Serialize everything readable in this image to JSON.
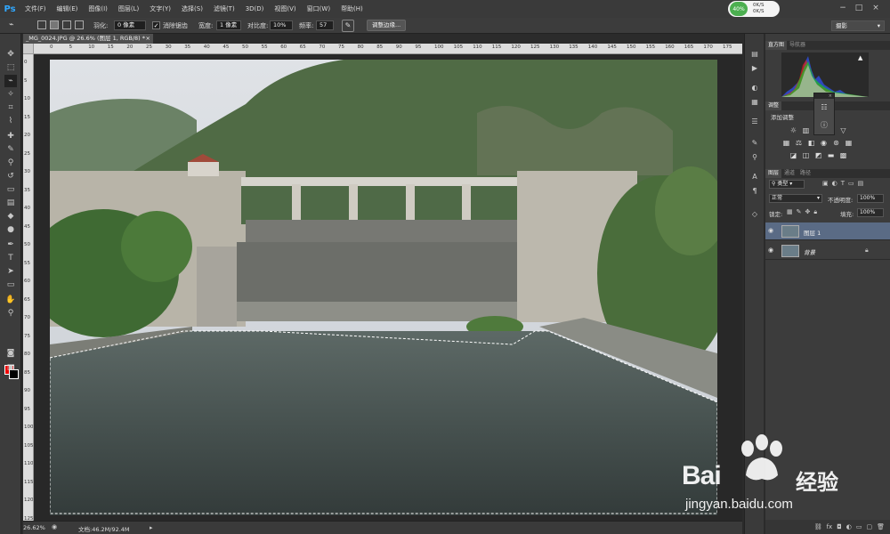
{
  "app": {
    "logo": "Ps"
  },
  "menu": [
    "文件(F)",
    "编辑(E)",
    "图像(I)",
    "图层(L)",
    "文字(Y)",
    "选择(S)",
    "滤镜(T)",
    "3D(D)",
    "视图(V)",
    "窗口(W)",
    "帮助(H)"
  ],
  "perf": {
    "percent": "40%",
    "up": "0K/S",
    "down": "0K/S"
  },
  "options": {
    "feather_label": "羽化:",
    "feather_value": "0 像素",
    "antialias_label": "消除锯齿",
    "antialias_checked": true,
    "width_label": "宽度:",
    "width_value": "1 像素",
    "contrast_label": "对比度:",
    "contrast_value": "10%",
    "frequency_label": "频率:",
    "frequency_value": "57",
    "refine_edge": "调整边缘...",
    "workspace": "摄影"
  },
  "document": {
    "tab_title": "_MG_0024.JPG @ 26.6% (图层 1, RGB/8) *",
    "close_glyph": "×"
  },
  "ruler": {
    "h_marks": [
      "0",
      "5",
      "10",
      "15",
      "20",
      "25",
      "30",
      "35",
      "40",
      "45",
      "50",
      "55",
      "60",
      "65",
      "70",
      "75",
      "80",
      "85",
      "90",
      "95",
      "100",
      "105",
      "110",
      "115",
      "120",
      "125",
      "130",
      "135",
      "140",
      "145",
      "150",
      "155",
      "160",
      "165",
      "170",
      "175"
    ],
    "v_marks": [
      "0",
      "5",
      "10",
      "15",
      "20",
      "25",
      "30",
      "35",
      "40",
      "45",
      "50",
      "55",
      "60",
      "65",
      "70",
      "75",
      "80",
      "85",
      "90",
      "95",
      "100",
      "105",
      "110",
      "115",
      "120",
      "125"
    ]
  },
  "status": {
    "zoom": "26.62%",
    "doc_size": "文档:46.2M/92.4M"
  },
  "panels": {
    "histogram_tabs": [
      "直方图",
      "导航器"
    ],
    "adjustments_tab": "调整",
    "adjustments_title": "添加调整",
    "layers_tabs": [
      "图层",
      "通道",
      "路径"
    ],
    "kind_filter": "类型",
    "blend_mode": "正常",
    "opacity_label": "不透明度:",
    "opacity_value": "100%",
    "lock_label": "锁定:",
    "fill_label": "填充:",
    "fill_value": "100%",
    "layers": [
      {
        "name": "图层 1",
        "selected": true
      },
      {
        "name": "背景",
        "selected": false,
        "locked": true
      }
    ]
  },
  "watermark": {
    "brand": "Bai",
    "brand_name": "经验",
    "url": "jingyan.baidu.com"
  },
  "colors": {
    "foreground": "#e00000",
    "background": "#000000",
    "accent": "#31a8ff",
    "selected_layer": "#5a6b85"
  }
}
